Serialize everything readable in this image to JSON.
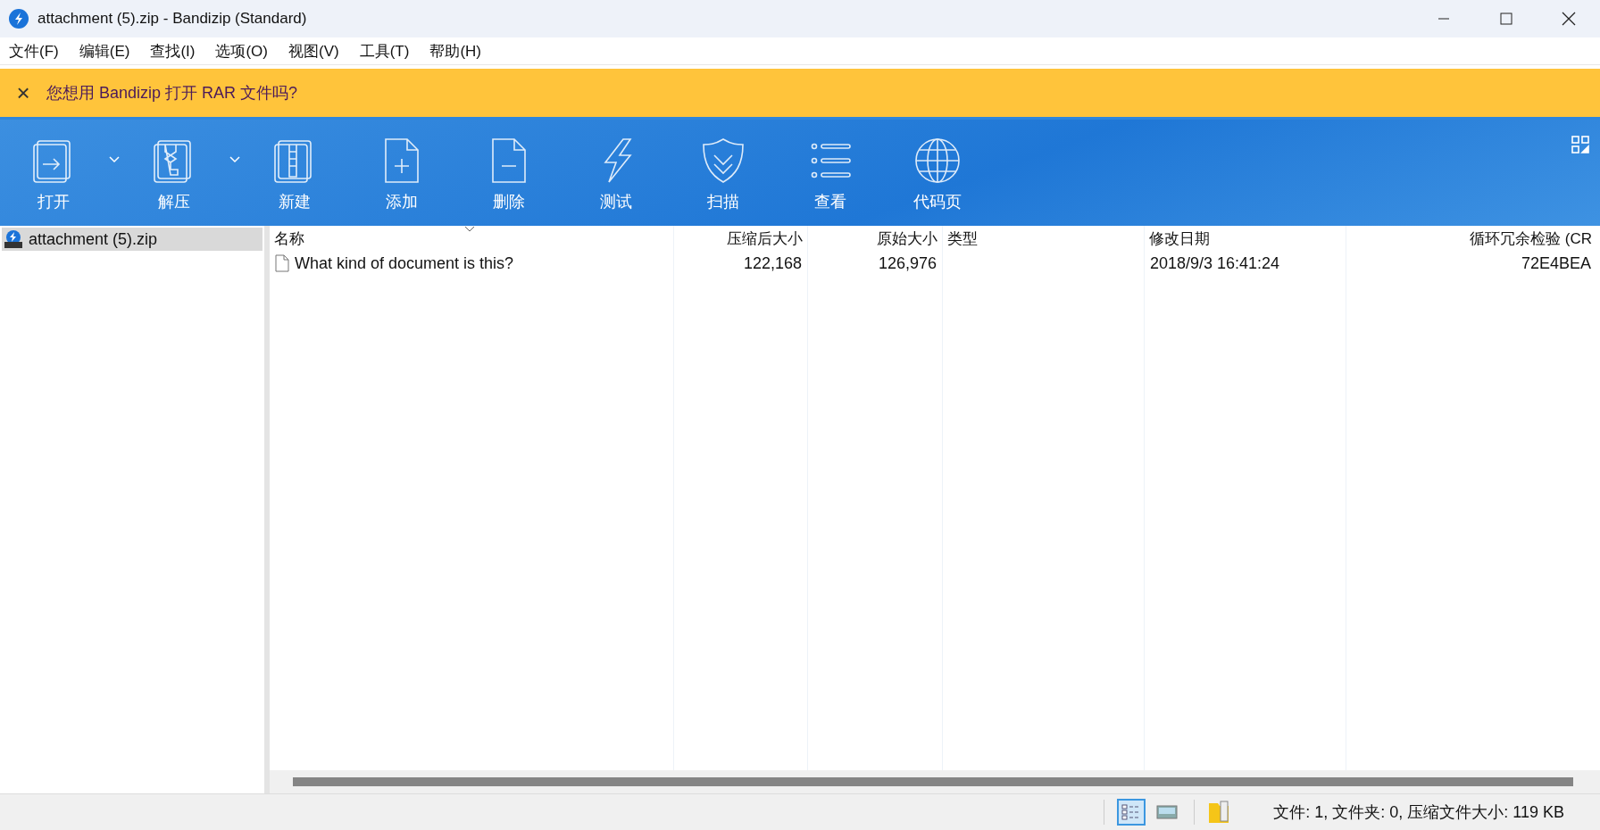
{
  "window": {
    "title": "attachment (5).zip - Bandizip (Standard)"
  },
  "menu": [
    "文件(F)",
    "编辑(E)",
    "查找(I)",
    "选项(O)",
    "视图(V)",
    "工具(T)",
    "帮助(H)"
  ],
  "banner": {
    "close": "×",
    "message": "您想用 Bandizip 打开 RAR 文件吗?"
  },
  "toolbar": [
    {
      "kind": "open",
      "label": "打开",
      "dropdown": true
    },
    {
      "kind": "extract",
      "label": "解压",
      "dropdown": true
    },
    {
      "kind": "new",
      "label": "新建",
      "dropdown": false
    },
    {
      "kind": "add",
      "label": "添加",
      "dropdown": false
    },
    {
      "kind": "delete",
      "label": "删除",
      "dropdown": false
    },
    {
      "kind": "test",
      "label": "测试",
      "dropdown": false
    },
    {
      "kind": "scan",
      "label": "扫描",
      "dropdown": false
    },
    {
      "kind": "view",
      "label": "查看",
      "dropdown": false
    },
    {
      "kind": "codepage",
      "label": "代码页",
      "dropdown": false
    }
  ],
  "sidebar": {
    "items": [
      {
        "label": "attachment (5).zip",
        "selected": true
      }
    ]
  },
  "table": {
    "columns": [
      {
        "label": "名称",
        "sorted": true
      },
      {
        "label": "压缩后大小",
        "sorted": false
      },
      {
        "label": "原始大小",
        "sorted": false
      },
      {
        "label": "类型",
        "sorted": false
      },
      {
        "label": "修改日期",
        "sorted": false
      },
      {
        "label": "循环冗余检验 (CR",
        "sorted": false
      }
    ],
    "rows": [
      {
        "cells": [
          "What kind of document is this?",
          "122,168",
          "126,976",
          "",
          "2018/9/3 16:41:24",
          "72E4BEA"
        ]
      }
    ]
  },
  "status_bar": {
    "views": [
      {
        "kind": "details",
        "selected": true
      },
      {
        "kind": "thumbnails",
        "selected": false
      }
    ],
    "text": "文件: 1, 文件夹: 0, 压缩文件大小: 119 KB"
  }
}
